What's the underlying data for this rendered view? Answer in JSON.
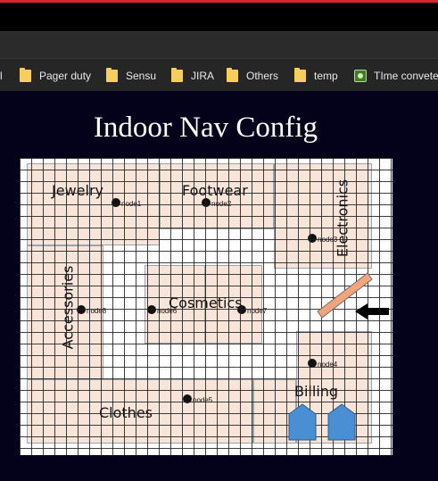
{
  "bookmarks": [
    {
      "label": "l",
      "icon": "none"
    },
    {
      "label": "Pager duty",
      "icon": "folder-icon"
    },
    {
      "label": "Sensu",
      "icon": "folder-icon"
    },
    {
      "label": "JIRA",
      "icon": "folder-icon"
    },
    {
      "label": "Others",
      "icon": "folder-icon"
    },
    {
      "label": "temp",
      "icon": "folder-icon"
    },
    {
      "label": "TIme convete",
      "icon": "site-favicon"
    }
  ],
  "page": {
    "title": "Indoor Nav Config"
  },
  "floor_plan": {
    "zones": {
      "jewelry": "Jewelry",
      "footwear": "Footwear",
      "electronics": "Electronics",
      "accessories": "Accessories",
      "cosmetics": "Cosmetics",
      "clothes": "Clothes",
      "billing": "Billing"
    },
    "nodes": [
      "node1",
      "node2",
      "node3",
      "node4",
      "node5",
      "node6",
      "node7",
      "node8"
    ]
  },
  "colors": {
    "zone_fill": "#f9e4da",
    "ramp": "#f4a47c",
    "billing_counter": "#4a8fd4",
    "browser_accent": "#d7262b"
  }
}
